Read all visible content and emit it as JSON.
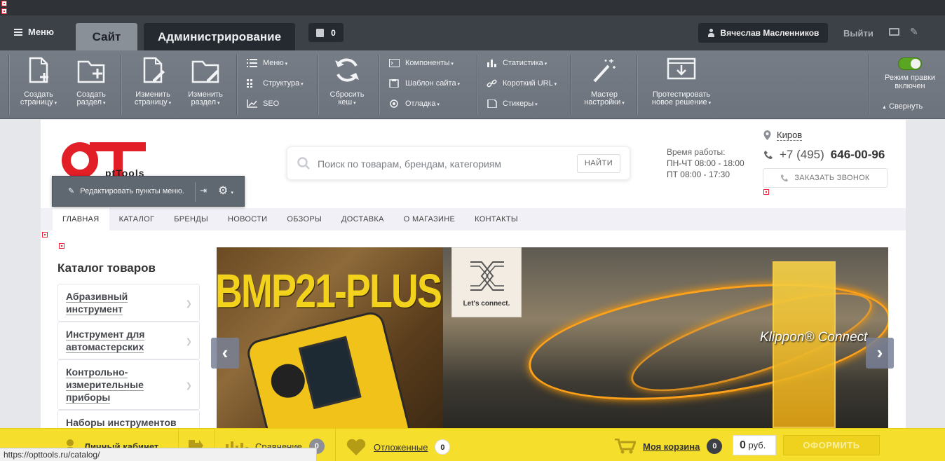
{
  "admin": {
    "menu_label": "Меню",
    "tab_site": "Сайт",
    "tab_admin": "Администрирование",
    "notifications_count": "0",
    "user_name": "Вячеслав Масленников",
    "logout_label": "Выйти"
  },
  "toolbar": {
    "create_page": [
      "Создать",
      "страницу"
    ],
    "create_section": [
      "Создать",
      "раздел"
    ],
    "edit_page": [
      "Изменить",
      "страницу"
    ],
    "edit_section": [
      "Изменить",
      "раздел"
    ],
    "menu": "Меню",
    "structure": "Структура",
    "seo": "SEO",
    "reset_cache": [
      "Сбросить",
      "кеш"
    ],
    "components": "Компоненты",
    "site_template": "Шаблон сайта",
    "debug": "Отладка",
    "statistics": "Статистика",
    "short_url": "Короткий URL",
    "stickers": "Стикеры",
    "wizard": [
      "Мастер",
      "настройки"
    ],
    "test_solution": [
      "Протестировать",
      "новое решение"
    ],
    "edit_mode": [
      "Режим правки",
      "включен"
    ],
    "edit_mode_on": true,
    "collapse": "Свернуть"
  },
  "site": {
    "logo_text": "ptTools",
    "search_placeholder": "Поиск по товарам, брендам, категориям",
    "search_button": "НАЙТИ",
    "hours_title": "Время работы:",
    "hours_weekdays": "ПН-ЧТ 08:00 - 18:00",
    "hours_friday": "ПТ 08:00 - 17:30",
    "city": "Киров",
    "phone_prefix": "+7 (495)",
    "phone_number": "646-00-96",
    "callback": "ЗАКАЗАТЬ ЗВОНОК",
    "edit_menu_items": "Редактировать пункты меню.",
    "nav": [
      "ГЛАВНАЯ",
      "КАТАЛОГ",
      "БРЕНДЫ",
      "НОВОСТИ",
      "ОБЗОРЫ",
      "ДОСТАВКА",
      "О МАГАЗИНЕ",
      "КОНТАКТЫ"
    ],
    "catalog_title": "Каталог товаров",
    "catalog": [
      "Абразивный инструмент",
      "Инструмент для автомастерских",
      "Контрольно-измерительные приборы",
      "Наборы инструментов"
    ],
    "slider": {
      "left_text": "BMP21-PLUS",
      "lets_connect": "Let's connect.",
      "brand": "Klippon® Connect"
    }
  },
  "bottom": {
    "cabinet": "Личный кабинет",
    "compare": "Сравнение",
    "compare_count": "0",
    "favorites": "Отложенные",
    "favorites_count": "0",
    "cart": "Моя корзина",
    "cart_count": "0",
    "sum_value": "0",
    "sum_unit": "руб.",
    "order": "ОФОРМИТЬ"
  },
  "status_url": "https://opttools.ru/catalog/",
  "colors": {
    "bottom_bar": "#f6df2c",
    "brand_red": "#e21e26",
    "toggle_on": "#5aa522"
  }
}
